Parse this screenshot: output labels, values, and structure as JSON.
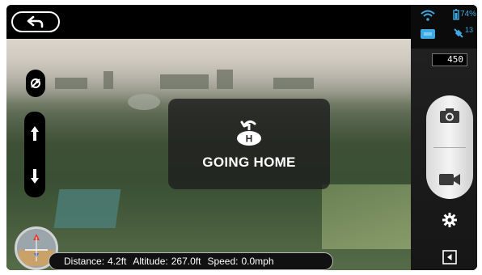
{
  "header": {
    "back_label": ""
  },
  "status_icons": {
    "battery_text": "74%",
    "satellite_text": "13",
    "wifi": "wifi-icon",
    "record_badge": "rec-badge-icon"
  },
  "altitude_box": {
    "value": "450"
  },
  "overlay": {
    "going_home_label": "GOING HOME"
  },
  "telemetry": {
    "distance_label": "Distance:",
    "distance_value": "4.2ft",
    "altitude_label": "Altitude:",
    "altitude_value": "267.0ft",
    "speed_label": "Speed:",
    "speed_value": "0.0mph"
  },
  "colors": {
    "accent_blue": "#3fa8e0",
    "background": "#000000",
    "overlay_bg": "#1e1e1e"
  }
}
